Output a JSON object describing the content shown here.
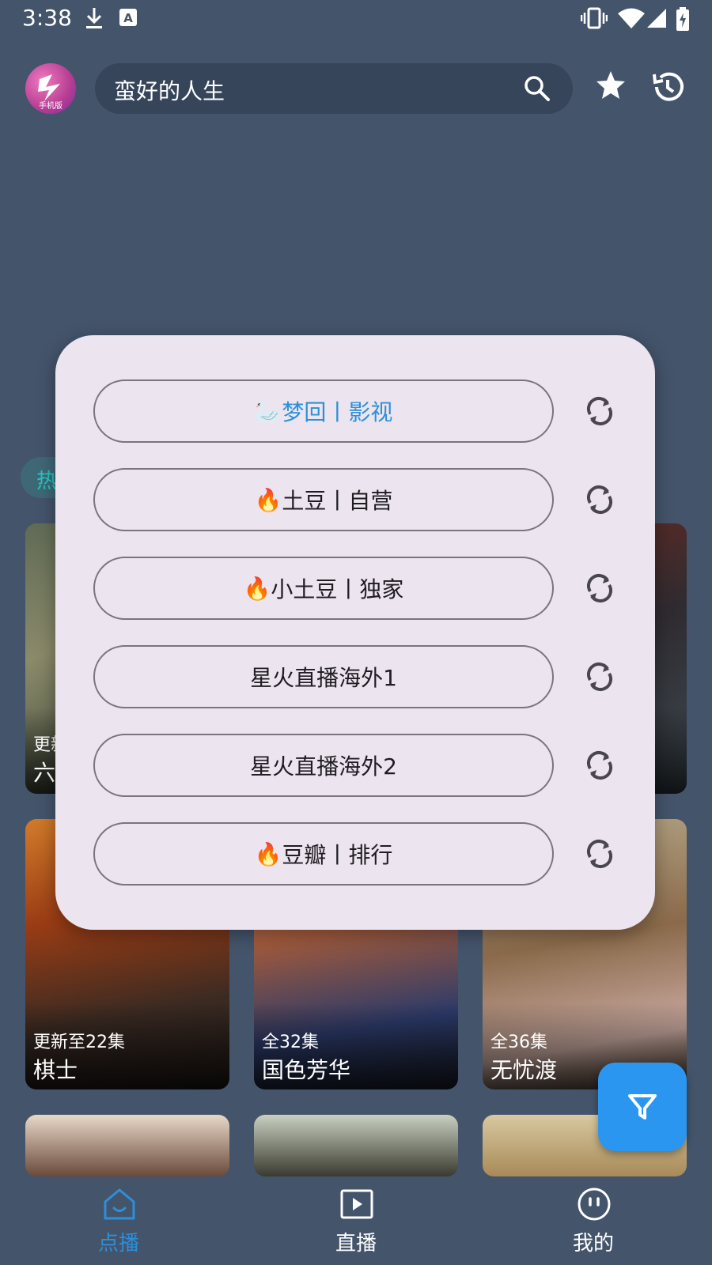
{
  "status_bar": {
    "time": "3:38"
  },
  "header": {
    "app_badge": "手机版",
    "search_text": "蛮好的人生"
  },
  "background": {
    "chip_label": "热",
    "row1": [
      {
        "update": "更新",
        "title": "六"
      }
    ],
    "row2": [
      {
        "update": "更新至22集",
        "title": "棋士"
      },
      {
        "update": "全32集",
        "title": "国色芳华"
      },
      {
        "update": "全36集",
        "title": "无忧渡"
      }
    ]
  },
  "dialog": {
    "sources": [
      {
        "icon": "🦢",
        "label": "梦回丨影视",
        "active": true
      },
      {
        "icon": "🔥",
        "label": "土豆丨自营",
        "active": false
      },
      {
        "icon": "🔥",
        "label": "小土豆丨独家",
        "active": false
      },
      {
        "icon": "",
        "label": "星火直播海外1",
        "active": false
      },
      {
        "icon": "",
        "label": "星火直播海外2",
        "active": false
      },
      {
        "icon": "🔥",
        "label": "豆瓣丨排行",
        "active": false
      }
    ]
  },
  "bottom_nav": {
    "items": [
      {
        "label": "点播",
        "active": true
      },
      {
        "label": "直播",
        "active": false
      },
      {
        "label": "我的",
        "active": false
      }
    ]
  },
  "colors": {
    "background": "#44546b",
    "search_bg": "#36455a",
    "dialog_bg": "#ece4ef",
    "accent_blue": "#2b90d9",
    "fab": "#2b96f0",
    "chip_text": "#27c7c2"
  }
}
